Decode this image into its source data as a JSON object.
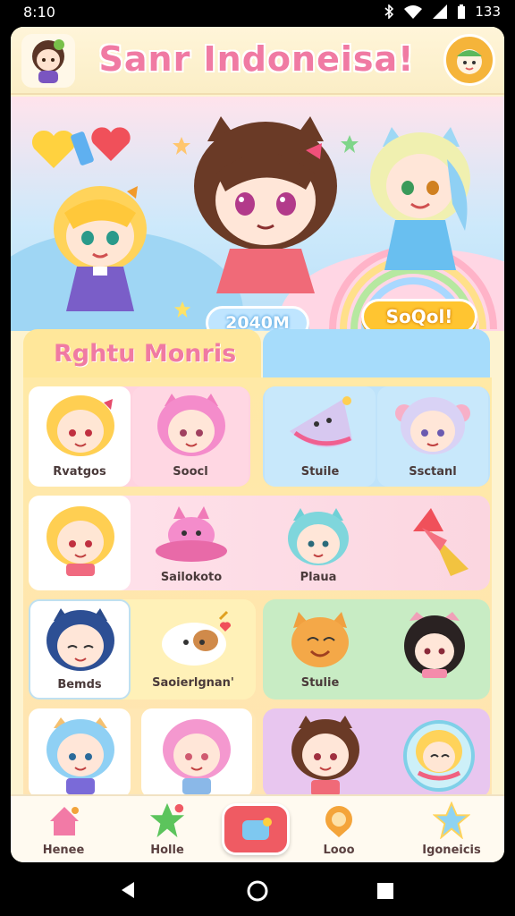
{
  "status_bar": {
    "time": "8:10",
    "battery": "133"
  },
  "app": {
    "title": "Sanr Indoneisa!",
    "hero": {
      "left_button": "2040M",
      "right_button": "SoQol!"
    },
    "section_title": "Rghtu Monris",
    "tiles": [
      {
        "label": "Rvatgos"
      },
      {
        "label": "Soocl"
      },
      {
        "label": "Stuile"
      },
      {
        "label": "Ssctanl"
      },
      {
        "label": ""
      },
      {
        "label": "Sailokoto"
      },
      {
        "label": "Plaua"
      },
      {
        "label": ""
      },
      {
        "label": "Bemds"
      },
      {
        "label": "Saoierlgnan'"
      },
      {
        "label": "Stulie"
      },
      {
        "label": ""
      }
    ],
    "bottom_nav": [
      {
        "label": "Henee",
        "icon": "house-icon"
      },
      {
        "label": "Holle",
        "icon": "star-icon"
      },
      {
        "label": "",
        "icon": "chat-icon"
      },
      {
        "label": "Looo",
        "icon": "location-icon"
      },
      {
        "label": "Igoneicis",
        "icon": "star-icon"
      }
    ]
  },
  "colors": {
    "accent_pink": "#f07aa3",
    "accent_yellow": "#ffc531",
    "accent_blue": "#a6dcfb",
    "nav_red": "#ef5b63"
  }
}
